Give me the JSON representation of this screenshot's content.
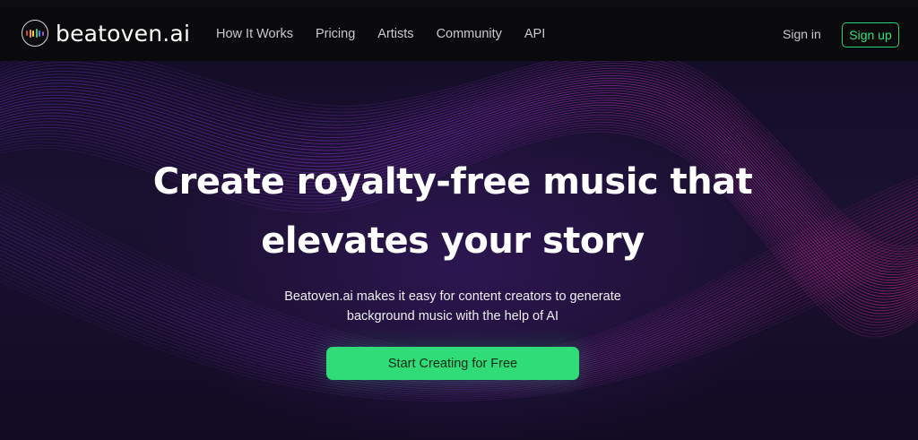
{
  "brand": {
    "name": "beatoven.ai",
    "logo_icon": "equalizer-bars-icon",
    "logo_bar_colors": [
      "#e0453a",
      "#f39c2b",
      "#f1d23a",
      "#47c46b",
      "#3d8ef0",
      "#9b59d0"
    ]
  },
  "nav": {
    "links": [
      "How It Works",
      "Pricing",
      "Artists",
      "Community",
      "API"
    ],
    "signin_label": "Sign in",
    "signup_label": "Sign up"
  },
  "hero": {
    "headline_line1": "Create royalty-free music that",
    "headline_line2": "elevates your story",
    "subtitle_line1": "Beatoven.ai makes it easy for content creators to generate",
    "subtitle_line2": "background music with the help of AI",
    "cta_label": "Start Creating for Free"
  },
  "colors": {
    "accent_green": "#2fdc77",
    "wave_purple": "#7a2fb8",
    "wave_magenta": "#d0287c",
    "background": "#130d25"
  }
}
